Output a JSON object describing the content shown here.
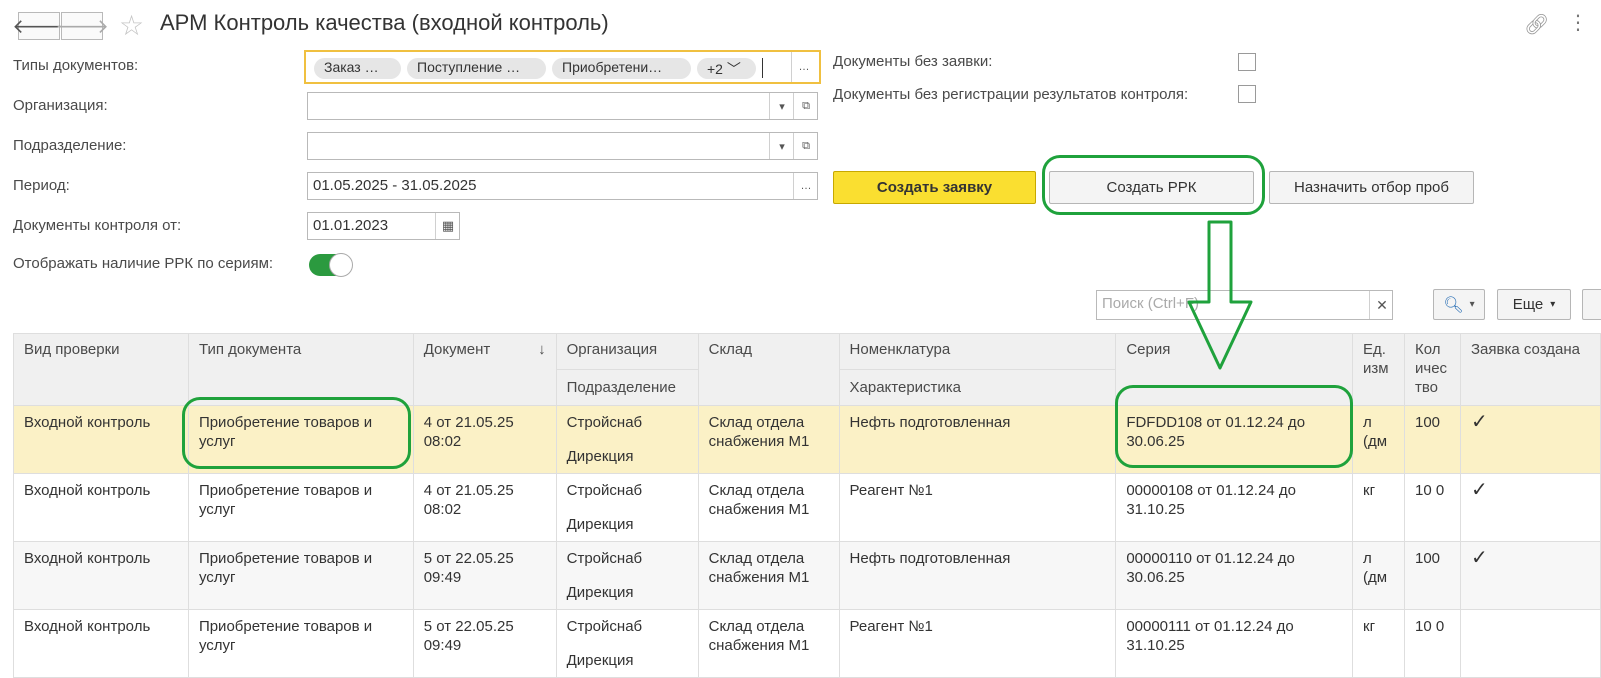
{
  "window": {
    "title": "АРМ Контроль качества (входной контроль)"
  },
  "filters": {
    "doc_types_label": "Типы документов:",
    "doc_types_chips": [
      "Заказ …",
      "Поступление …",
      "Приобретени…",
      "+2"
    ],
    "org_label": "Организация:",
    "org_value": "",
    "subdiv_label": "Подразделение:",
    "subdiv_value": "",
    "period_label": "Период:",
    "period_value": "01.05.2025 - 31.05.2025",
    "control_from_label": "Документы контроля от:",
    "control_from_value": "01.01.2023",
    "show_rrk_label": "Отображать наличие РРК по сериям:",
    "show_rrk_on": true,
    "no_request_label": "Документы без заявки:",
    "no_control_label": "Документы без регистрации результатов контроля:"
  },
  "buttons": {
    "create_request": "Создать заявку",
    "create_rrk": "Создать РРК",
    "assign_samples": "Назначить отбор проб",
    "more": "Еще",
    "more_dots": "…"
  },
  "search": {
    "placeholder": "Поиск (Ctrl+F)"
  },
  "table": {
    "headers": {
      "check_type": "Вид проверки",
      "doc_type": "Тип документа",
      "document": "Документ",
      "sort_mark": "↓",
      "organization": "Организация",
      "subdivision": "Подразделение",
      "warehouse": "Склад",
      "nomenclature": "Номенклатура",
      "characteristic": "Характеристика",
      "series": "Серия",
      "unit": "Ед. изм",
      "qty": "Кол ичес тво",
      "request_created": "Заявка создана"
    },
    "rows": [
      {
        "check_type": "Входной контроль",
        "doc_type": "Приобретение товаров и услуг",
        "document": "4 от 21.05.25 08:02",
        "organization": "Стройснаб",
        "subdivision": "Дирекция",
        "warehouse": "Склад отдела снабжения М1",
        "nomenclature": "Нефть подготовленная",
        "series": "FDFDD108 от 01.12.24 до 30.06.25",
        "unit": "л (дм",
        "qty": "100",
        "request_created": "✓"
      },
      {
        "check_type": "Входной контроль",
        "doc_type": "Приобретение товаров и услуг",
        "document": "4 от 21.05.25 08:02",
        "organization": "Стройснаб",
        "subdivision": "Дирекция",
        "warehouse": "Склад отдела снабжения М1",
        "nomenclature": "Реагент №1",
        "series": "00000108 от 01.12.24 до 31.10.25",
        "unit": "кг",
        "qty": "10 0",
        "request_created": "✓"
      },
      {
        "check_type": "Входной контроль",
        "doc_type": "Приобретение товаров и услуг",
        "document": "5 от 22.05.25 09:49",
        "organization": "Стройснаб",
        "subdivision": "Дирекция",
        "warehouse": "Склад отдела снабжения М1",
        "nomenclature": "Нефть подготовленная",
        "series": "00000110 от 01.12.24 до 30.06.25",
        "unit": "л (дм",
        "qty": "100",
        "request_created": "✓"
      },
      {
        "check_type": "Входной контроль",
        "doc_type": "Приобретение товаров и услуг",
        "document": "5 от 22.05.25 09:49",
        "organization": "Стройснаб",
        "subdivision": "Дирекция",
        "warehouse": "Склад отдела снабжения М1",
        "nomenclature": "Реагент №1",
        "series": "00000111 от 01.12.24 до 31.10.25",
        "unit": "кг",
        "qty": "10 0",
        "request_created": ""
      }
    ]
  },
  "colors": {
    "accent_yellow": "#fadf30",
    "highlight_green": "#1fa23c",
    "selected_row": "#fbf1c6",
    "check_green": "#2b9a3f"
  }
}
